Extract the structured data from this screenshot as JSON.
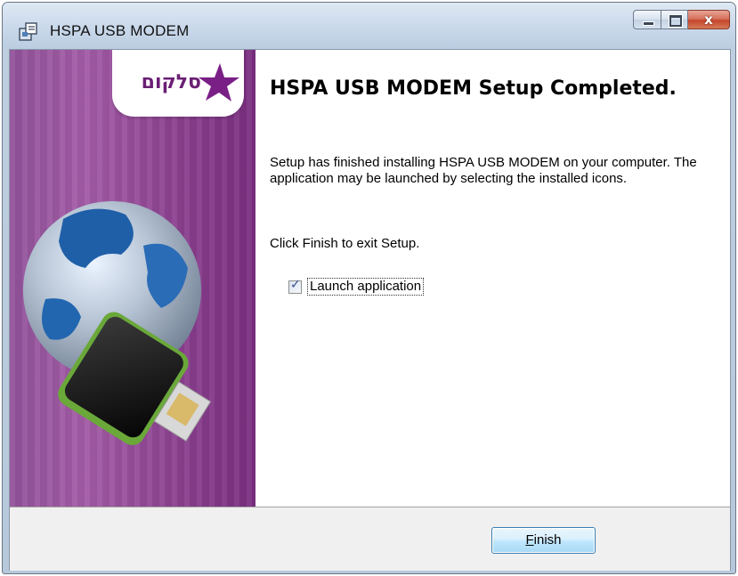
{
  "window": {
    "title": "HSPA USB MODEM",
    "caption_close_glyph": "x"
  },
  "sidebar": {
    "logo_text": "סלקום",
    "brand_color": "#8a3f8e",
    "logo_icon": "cellcom-star-logo",
    "artwork": "globe-usb-modem-illustration"
  },
  "main": {
    "heading": "HSPA USB MODEM Setup Completed.",
    "paragraph1": "Setup has finished installing HSPA USB MODEM on your computer. The application may be launched by selecting the installed icons.",
    "paragraph2": "Click Finish to exit Setup.",
    "launch_checkbox": {
      "label": "Launch application",
      "checked": true
    }
  },
  "footer": {
    "finish_label_mnemonic": "F",
    "finish_label_rest": "inish"
  }
}
